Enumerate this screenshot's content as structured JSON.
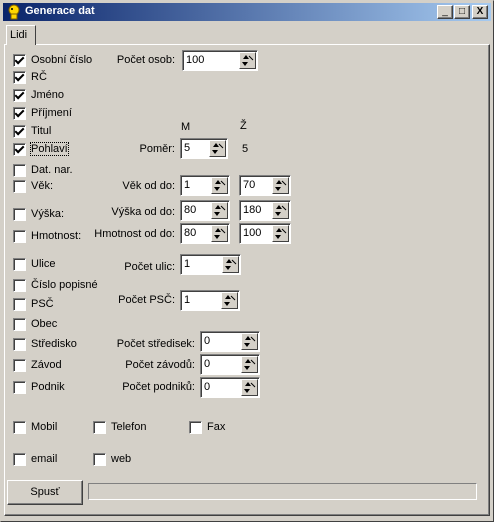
{
  "window": {
    "title": "Generace dat"
  },
  "caption_buttons": {
    "minimize": "_",
    "maximize": "□",
    "close": "X"
  },
  "tab": {
    "label": "Lidi"
  },
  "checkboxes": {
    "osobni_cislo": {
      "label": "Osobní číslo",
      "checked": true
    },
    "rc": {
      "label": "RČ",
      "checked": true
    },
    "jmeno": {
      "label": "Jméno",
      "checked": true
    },
    "prijmeni": {
      "label": "Příjmení",
      "checked": true
    },
    "titul": {
      "label": "Titul",
      "checked": true
    },
    "pohlavi": {
      "label": "Pohlaví",
      "checked": true
    },
    "dat_nar": {
      "label": "Dat. nar.",
      "checked": false
    },
    "vek": {
      "label": "Věk:",
      "checked": false
    },
    "vyska": {
      "label": "Výška:",
      "checked": false
    },
    "hmotnost": {
      "label": "Hmotnost:",
      "checked": false
    },
    "ulice": {
      "label": "Ulice",
      "checked": false
    },
    "cislo_popisne": {
      "label": "Číslo popisné",
      "checked": false
    },
    "psc": {
      "label": "PSČ",
      "checked": false
    },
    "obec": {
      "label": "Obec",
      "checked": false
    },
    "stredisko": {
      "label": "Středisko",
      "checked": false
    },
    "zavod": {
      "label": "Závod",
      "checked": false
    },
    "podnik": {
      "label": "Podnik",
      "checked": false
    },
    "mobil": {
      "label": "Mobil",
      "checked": false
    },
    "telefon": {
      "label": "Telefon",
      "checked": false
    },
    "fax": {
      "label": "Fax",
      "checked": false
    },
    "email": {
      "label": "email",
      "checked": false
    },
    "web": {
      "label": "web",
      "checked": false
    }
  },
  "fields": {
    "pocet_osob": {
      "label": "Počet osob:",
      "value": "100"
    },
    "pomer_header_m": "M",
    "pomer_header_z": "Ž",
    "pomer": {
      "label": "Poměr:",
      "value": "5",
      "right_value": "5"
    },
    "vek": {
      "label": "Věk od do:",
      "from": "1",
      "to": "70"
    },
    "vyska": {
      "label": "Výška od do:",
      "from": "80",
      "to": "180"
    },
    "hmotnost": {
      "label": "Hmotnost od do:",
      "from": "80",
      "to": "100"
    },
    "pocet_ulic": {
      "label": "Počet ulic:",
      "value": "1"
    },
    "pocet_psc": {
      "label": "Počet PSČ:",
      "value": "1"
    },
    "pocet_stredisek": {
      "label": "Počet středisek:",
      "value": "0"
    },
    "pocet_zavodu": {
      "label": "Počet závodů:",
      "value": "0"
    },
    "pocet_podniku": {
      "label": "Počet podniků:",
      "value": "0"
    }
  },
  "actions": {
    "spustit": "Spusť"
  },
  "progress": {
    "value": 0
  }
}
